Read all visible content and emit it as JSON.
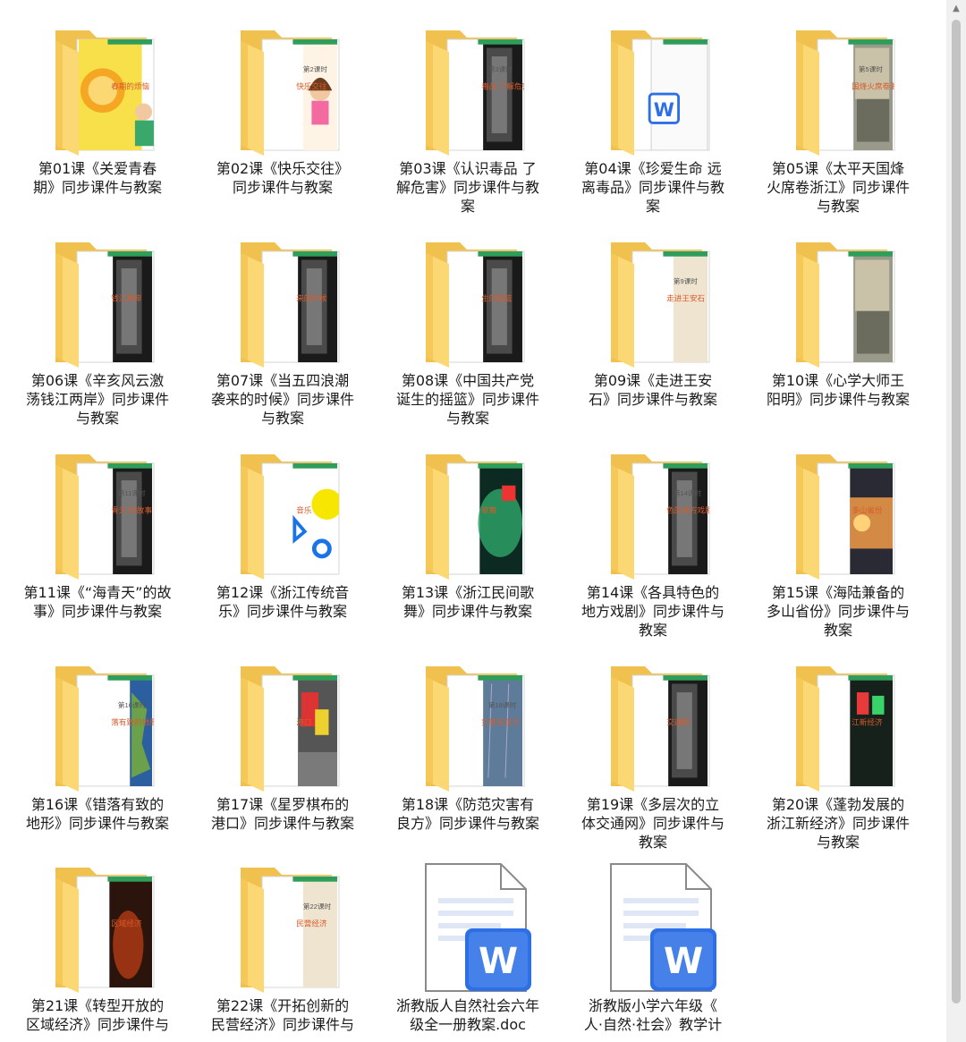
{
  "items": [
    {
      "type": "folder",
      "label": "第01课《关爱青春期》同步课件与教案",
      "line1": "第01课《关爱青春",
      "line2": "期》同步课件与教案",
      "line3": "",
      "preview": "cartoon",
      "doc_title": "",
      "doc_sub": "春期的烦恼"
    },
    {
      "type": "folder",
      "label": "第02课《快乐交往》同步课件与教案",
      "line1": "第02课《快乐交往》",
      "line2": "同步课件与教案",
      "line3": "",
      "preview": "doc-cartoon",
      "doc_title": "第2课时",
      "doc_sub": "快乐交往"
    },
    {
      "type": "folder",
      "label": "第03课《认识毒品 了解危害》同步课件与教案",
      "line1": "第03课《认识毒品 了",
      "line2": "解危害》同步课件与教",
      "line3": "案",
      "preview": "dark",
      "doc_title": "第3课时",
      "doc_sub": "毒品 了解危害"
    },
    {
      "type": "folder",
      "label": "第04课《珍爱生命 远离毒品》同步课件与教案",
      "line1": "第04课《珍爱生命 远",
      "line2": "离毒品》同步课件与教",
      "line3": "案",
      "preview": "word",
      "doc_title": "",
      "doc_sub": ""
    },
    {
      "type": "folder",
      "label": "第05课《太平天国烽火席卷浙江》同步课件与教案",
      "line1": "第05课《太平天国烽",
      "line2": "火席卷浙江》同步课件",
      "line3": "与教案",
      "preview": "photo",
      "doc_title": "第5课时",
      "doc_sub": "国烽火席卷浙"
    },
    {
      "type": "folder",
      "label": "第06课《辛亥风云激荡钱江两岸》同步课件与教案",
      "line1": "第06课《辛亥风云激",
      "line2": "荡钱江两岸》同步课件",
      "line3": "与教案",
      "preview": "dark",
      "doc_title": "",
      "doc_sub": "钱江两岸"
    },
    {
      "type": "folder",
      "label": "第07课《当五四浪潮袭来的时候》同步课件与教案",
      "line1": "第07课《当五四浪潮",
      "line2": "袭来的时候》同步课件",
      "line3": "与教案",
      "preview": "dark",
      "doc_title": "",
      "doc_sub": "来的时候"
    },
    {
      "type": "folder",
      "label": "第08课《中国共产党诞生的摇篮》同步课件与教案",
      "line1": "第08课《中国共产党",
      "line2": "诞生的摇篮》同步课件",
      "line3": "与教案",
      "preview": "dark",
      "doc_title": "",
      "doc_sub": "生的摇篮"
    },
    {
      "type": "folder",
      "label": "第09课《走进王安石》同步课件与教案",
      "line1": "第09课《走进王安",
      "line2": "石》同步课件与教案",
      "line3": "",
      "preview": "paper",
      "doc_title": "第9课时",
      "doc_sub": "走进王安石"
    },
    {
      "type": "folder",
      "label": "第10课《心学大师王阳明》同步课件与教案",
      "line1": "第10课《心学大师王",
      "line2": "阳明》同步课件与教案",
      "line3": "",
      "preview": "photo",
      "doc_title": "",
      "doc_sub": ""
    },
    {
      "type": "folder",
      "label": "第11课《“海青天”的故事》同步课件与教案",
      "line1": "第11课《“海青天”的故",
      "line2": "事》同步课件与教案",
      "line3": "",
      "preview": "dark",
      "doc_title": "第11课时",
      "doc_sub": "青天”的故事"
    },
    {
      "type": "folder",
      "label": "第12课《浙江传统音乐》同步课件与教案",
      "line1": "第12课《浙江传统音",
      "line2": "乐》同步课件与教案",
      "line3": "",
      "preview": "shapes",
      "doc_title": "",
      "doc_sub": "音乐"
    },
    {
      "type": "folder",
      "label": "第13课《浙江民间歌舞》同步课件与教案",
      "line1": "第13课《浙江民间歌",
      "line2": "舞》同步课件与教案",
      "line3": "",
      "preview": "green",
      "doc_title": "",
      "doc_sub": "歌舞"
    },
    {
      "type": "folder",
      "label": "第14课《各具特色的地方戏剧》同步课件与教案",
      "line1": "第14课《各具特色的",
      "line2": "地方戏剧》同步课件与",
      "line3": "教案",
      "preview": "dark",
      "doc_title": "第14课时",
      "doc_sub": "色的地方戏剧"
    },
    {
      "type": "folder",
      "label": "第15课《海陆兼备的多山省份》同步课件与教案",
      "line1": "第15课《海陆兼备的",
      "line2": "多山省份》同步课件与",
      "line3": "教案",
      "preview": "sunset",
      "doc_title": "",
      "doc_sub": "多山省份"
    },
    {
      "type": "folder",
      "label": "第16课《错落有致的地形》同步课件与教案",
      "line1": "第16课《错落有致的",
      "line2": "地形》同步课件与教案",
      "line3": "",
      "preview": "map",
      "doc_title": "第16课时",
      "doc_sub": "落有致的地形"
    },
    {
      "type": "folder",
      "label": "第17课《星罗棋布的港口》同步课件与教案",
      "line1": "第17课《星罗棋布的",
      "line2": "港口》同步课件与教案",
      "line3": "",
      "preview": "port",
      "doc_title": "",
      "doc_sub": "港口"
    },
    {
      "type": "folder",
      "label": "第18课《防范灾害有良方》同步课件与教案",
      "line1": "第18课《防范灾害有",
      "line2": "良方》同步课件与教案",
      "line3": "",
      "preview": "rain",
      "doc_title": "第18课时",
      "doc_sub": "灾害有良方"
    },
    {
      "type": "folder",
      "label": "第19课《多层次的立体交通网》同步课件与教案",
      "line1": "第19课《多层次的立",
      "line2": "体交通网》同步课件与",
      "line3": "教案",
      "preview": "dark",
      "doc_title": "",
      "doc_sub": "交通网"
    },
    {
      "type": "folder",
      "label": "第20课《蓬勃发展的浙江新经济》同步课件与教案",
      "line1": "第20课《蓬勃发展的",
      "line2": "浙江新经济》同步课件",
      "line3": "与教案",
      "preview": "neon",
      "doc_title": "",
      "doc_sub": "江新经济"
    },
    {
      "type": "folder",
      "label": "第21课《转型开放的区域经济》同步课件与",
      "line1": "第21课《转型开放的",
      "line2": "区域经济》同步课件与",
      "line3": "",
      "preview": "fire",
      "doc_title": "",
      "doc_sub": "区域经济"
    },
    {
      "type": "folder",
      "label": "第22课《开拓创新的民营经济》同步课件与",
      "line1": "第22课《开拓创新的",
      "line2": "民营经济》同步课件与",
      "line3": "",
      "preview": "paper",
      "doc_title": "第22课时",
      "doc_sub": "民营经济"
    },
    {
      "type": "doc",
      "label": "浙教版人自然社会六年级全一册教案.doc",
      "line1": "浙教版人自然社会六年",
      "line2": "级全一册教案.doc",
      "line3": "",
      "preview": "",
      "doc_title": "",
      "doc_sub": ""
    },
    {
      "type": "doc",
      "label": "浙教版小学六年级《人·自然·社会》教学计",
      "line1": "浙教版小学六年级《",
      "line2": "人·自然·社会》教学计",
      "line3": "",
      "preview": "",
      "doc_title": "",
      "doc_sub": ""
    }
  ],
  "word_letter": "W",
  "colors": {
    "folder_back": "#f0c14e",
    "folder_front": "#fbd873",
    "folder_front_dark": "#f5c857",
    "word_blue": "#2d6fe6",
    "doc_lines": "#dfe6f5",
    "caption": "#1b1b1b",
    "green_bar": "#2f9e5a"
  }
}
